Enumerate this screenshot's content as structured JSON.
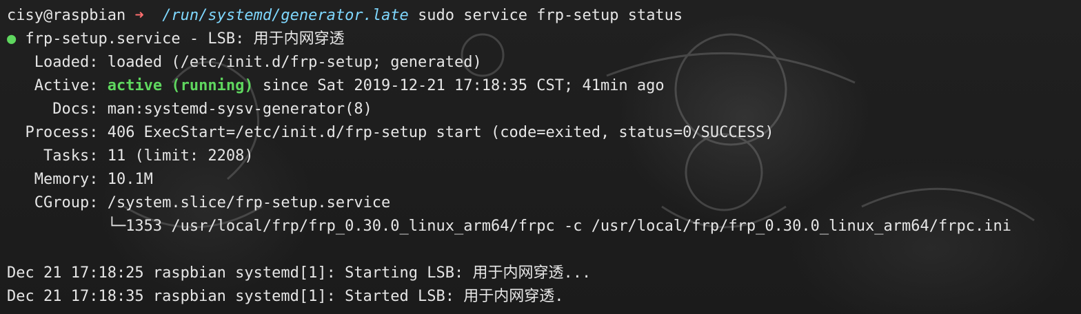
{
  "terminal": {
    "prompt": {
      "user_host": "cisy@raspbian",
      "arrow": "➜",
      "path": "/run/systemd/generator.late",
      "command": "sudo service frp-setup status"
    },
    "status": {
      "bullet": "●",
      "unit_line": "frp-setup.service - LSB: 用于内网穿透",
      "loaded_key": "   Loaded:",
      "loaded_val": "loaded (/etc/init.d/frp-setup; generated)",
      "active_key": "   Active:",
      "active_state": "active (running)",
      "active_rest": "since Sat 2019-12-21 17:18:35 CST; 41min ago",
      "docs_key": "     Docs:",
      "docs_val": "man:systemd-sysv-generator(8)",
      "process_key": "  Process:",
      "process_val": "406 ExecStart=/etc/init.d/frp-setup start (code=exited, status=0/SUCCESS)",
      "tasks_key": "    Tasks:",
      "tasks_val": "11 (limit: 2208)",
      "memory_key": "   Memory:",
      "memory_val": "10.1M",
      "cgroup_key": "   CGroup:",
      "cgroup_val": "/system.slice/frp-setup.service",
      "cgroup_child": "           └─1353 /usr/local/frp/frp_0.30.0_linux_arm64/frpc -c /usr/local/frp/frp_0.30.0_linux_arm64/frpc.ini"
    },
    "logs": [
      "Dec 21 17:18:25 raspbian systemd[1]: Starting LSB: 用于内网穿透...",
      "Dec 21 17:18:35 raspbian systemd[1]: Started LSB: 用于内网穿透."
    ]
  },
  "colors": {
    "background": "#1c1c1c",
    "text": "#e6e6e6",
    "prompt_arrow": "#ff6f6f",
    "prompt_path": "#7fd8ff",
    "active_green": "#5fd75f"
  }
}
